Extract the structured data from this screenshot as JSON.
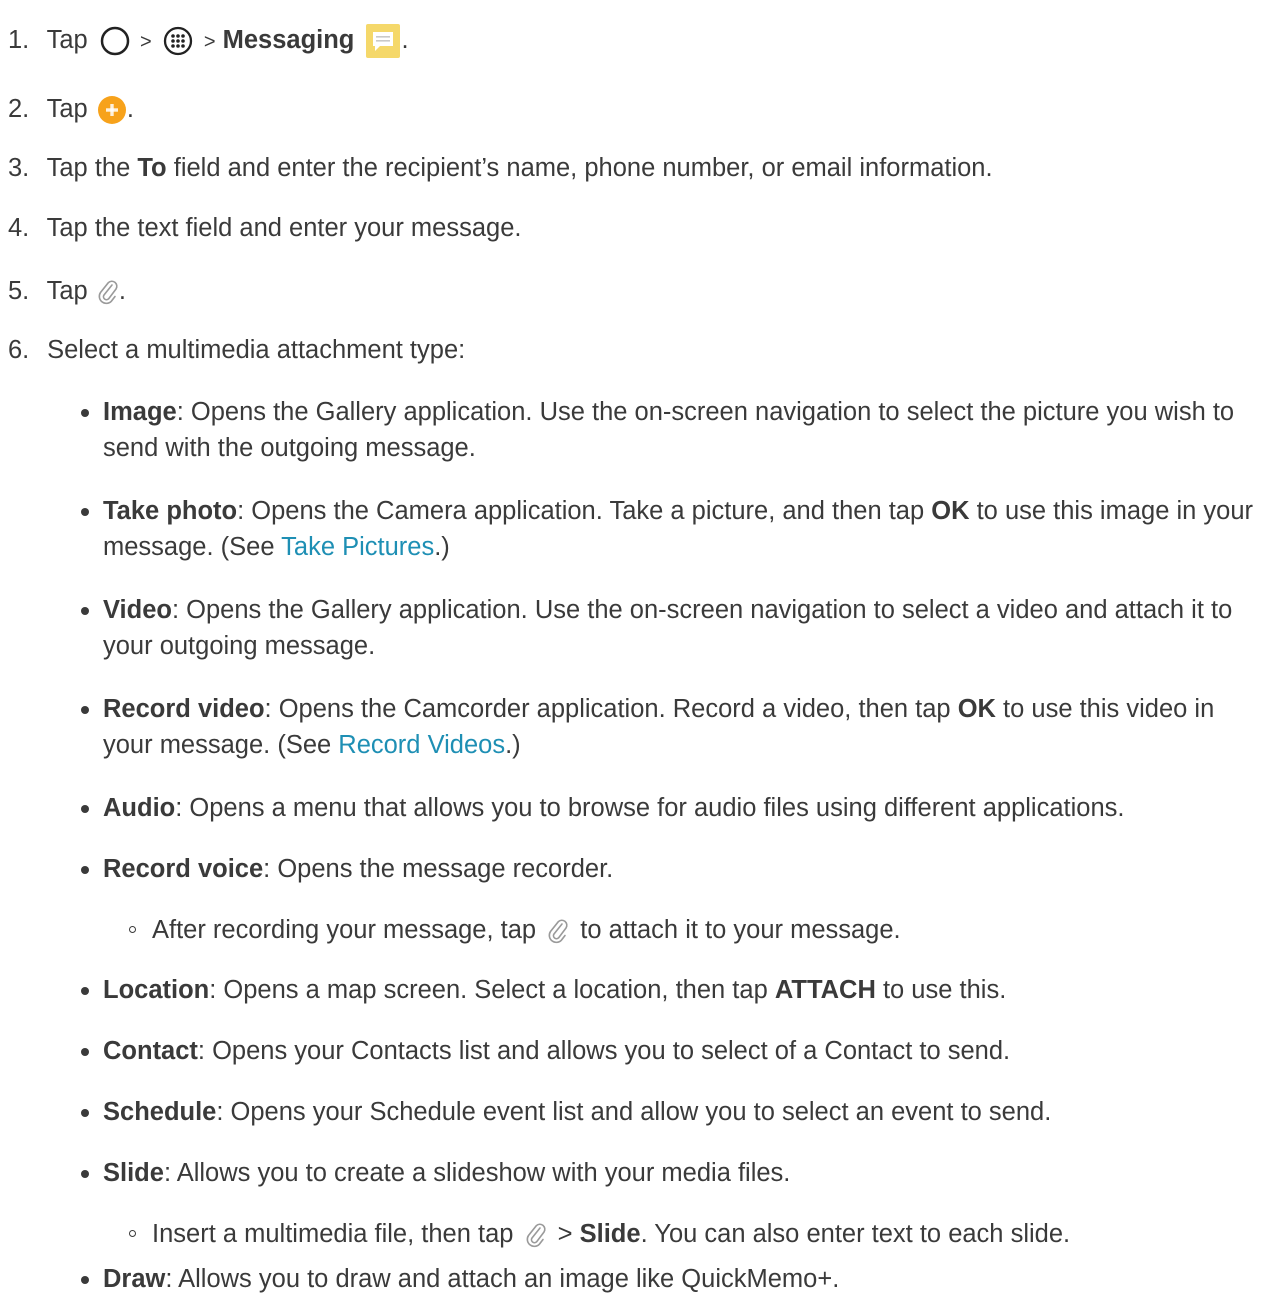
{
  "steps": [
    {
      "num": "1.",
      "tap": "Tap",
      "sep1": ">",
      "sep2": ">",
      "app": "Messaging",
      "end": "."
    },
    {
      "num": "2.",
      "tap": "Tap",
      "end": "."
    },
    {
      "num": "3.",
      "pre": "Tap the",
      "bold": "To",
      "post": "field and enter the recipient’s name, phone number, or email information."
    },
    {
      "num": "4.",
      "text": "Tap the text field and enter your message."
    },
    {
      "num": "5.",
      "tap": "Tap",
      "end": "."
    },
    {
      "num": "6.",
      "text": "Select a multimedia attachment type:"
    }
  ],
  "options": {
    "image": {
      "term": "Image",
      "desc": ": Opens the Gallery application. Use the on-screen navigation to select the picture you wish to send with the outgoing message."
    },
    "take_photo": {
      "term": "Take photo",
      "desc1": ": Opens the Camera application. Take a picture, and then tap ",
      "ok": "OK",
      "desc2": " to use this image in your message. (See ",
      "link": "Take Pictures",
      "desc3": ".)"
    },
    "video": {
      "term": "Video",
      "desc": ": Opens the Gallery application. Use the on-screen navigation to select a video and attach it to your outgoing message."
    },
    "record_video": {
      "term": "Record video",
      "desc1": ": Opens the Camcorder application. Record a video, then tap ",
      "ok": "OK",
      "desc2": " to use this video in your message. (See ",
      "link": "Record Videos",
      "desc3": ".)"
    },
    "audio": {
      "term": "Audio",
      "desc": ": Opens a menu that allows you to browse for audio files using different applications."
    },
    "record_voice": {
      "term": "Record voice",
      "desc": ": Opens the message recorder.",
      "sub_pre": "After recording your message, tap",
      "sub_post": "to attach it to your message."
    },
    "location": {
      "term": "Location",
      "desc1": ": Opens a map screen. Select a location, then tap ",
      "attach": "ATTACH",
      "desc2": " to use this."
    },
    "contact": {
      "term": "Contact",
      "desc": ": Opens your Contacts list and allows you to select of a Contact to send."
    },
    "schedule": {
      "term": "Schedule",
      "desc": ": Opens your Schedule event list and allow you to select an event to send."
    },
    "slide": {
      "term": "Slide",
      "desc": ": Allows you to create a slideshow with your media files.",
      "sub_pre": "Insert a multimedia file, then tap",
      "sub_sep": ">",
      "sub_bold": "Slide",
      "sub_post": ". You can also enter text to each slide."
    },
    "draw": {
      "term": "Draw",
      "desc": ": Allows you to draw and attach an image like QuickMemo+."
    }
  },
  "icons": {
    "home": "home-circle-icon",
    "apps": "apps-grid-icon",
    "messaging": "messaging-app-icon",
    "new_message": "new-message-plus-icon",
    "attach": "paperclip-icon"
  },
  "colors": {
    "text": "#3a3a3a",
    "link": "#1e8fb4",
    "messaging_icon": "#f5d86a",
    "new_message": "#f7a21b"
  }
}
